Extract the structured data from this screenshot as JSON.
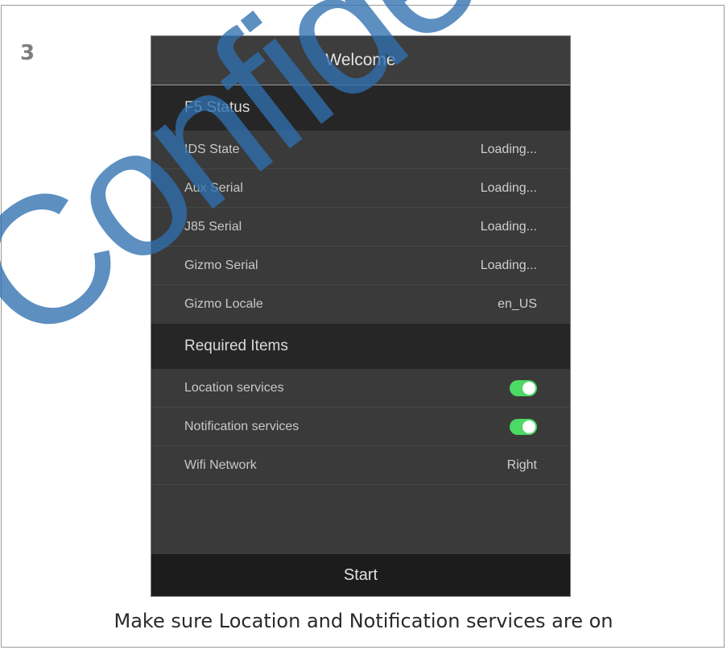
{
  "step": {
    "number": "3"
  },
  "watermark": {
    "text": "Confidential",
    "color": "#2f6fae"
  },
  "app": {
    "title": "Welcome",
    "sections": [
      {
        "title": "F5 Status",
        "rows": [
          {
            "label": "IDS State",
            "value": "Loading..."
          },
          {
            "label": "Aux Serial",
            "value": "Loading..."
          },
          {
            "label": "J85 Serial",
            "value": "Loading..."
          },
          {
            "label": "Gizmo Serial",
            "value": "Loading..."
          },
          {
            "label": "Gizmo Locale",
            "value": "en_US"
          }
        ]
      },
      {
        "title": "Required Items",
        "rows": [
          {
            "label": "Location services",
            "toggle": true
          },
          {
            "label": "Notification services",
            "toggle": true
          },
          {
            "label": "Wifi Network",
            "value": "Right"
          }
        ]
      }
    ],
    "start_label": "Start",
    "toggle_on_color": "#4cd964"
  },
  "caption": "Make sure Location and Notification services are on"
}
